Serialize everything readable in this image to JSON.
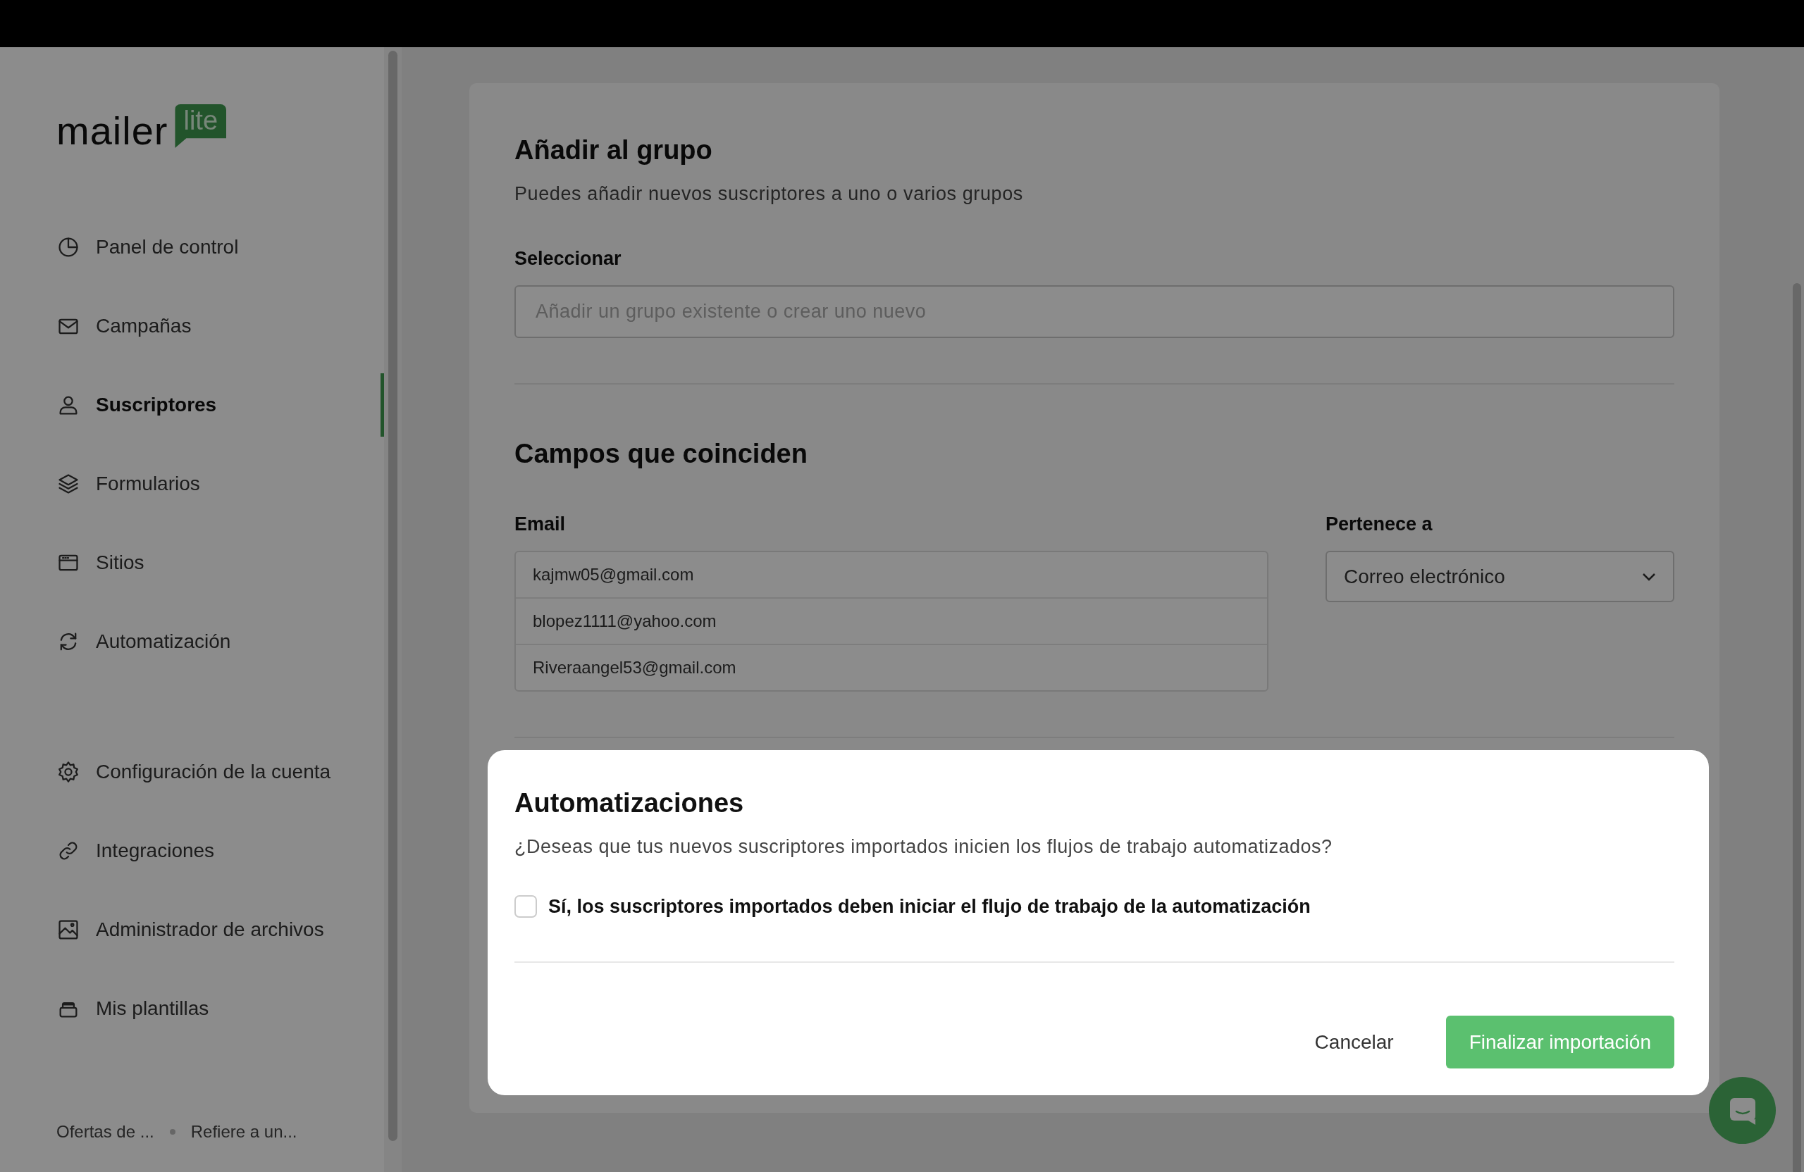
{
  "logo": {
    "word": "mailer",
    "badge": "lite"
  },
  "sidebar": {
    "items": [
      {
        "label": "Panel de control",
        "selected": false
      },
      {
        "label": "Campañas",
        "selected": false
      },
      {
        "label": "Suscriptores",
        "selected": true
      },
      {
        "label": "Formularios",
        "selected": false
      },
      {
        "label": "Sitios",
        "selected": false
      },
      {
        "label": "Automatización",
        "selected": false
      }
    ],
    "secondary_items": [
      {
        "label": "Configuración de la cuenta",
        "selected": false
      },
      {
        "label": "Integraciones",
        "selected": false
      },
      {
        "label": "Administrador de archivos",
        "selected": false
      },
      {
        "label": "Mis plantillas",
        "selected": false
      }
    ],
    "footer_links": [
      "Ofertas de ...",
      "Refiere a un..."
    ]
  },
  "group_section": {
    "title": "Añadir al grupo",
    "subtitle": "Puedes añadir nuevos suscriptores a uno o varios grupos",
    "field": {
      "label": "Seleccionar",
      "placeholder": "Añadir un grupo existente o crear uno nuevo"
    }
  },
  "fields_section": {
    "title": "Campos que coinciden",
    "email_label": "Email",
    "emails": [
      "kajmw05@gmail.com",
      "blopez1111@yahoo.com",
      "Riveraangel53@gmail.com"
    ],
    "belongs_label": "Pertenece a",
    "belongs_value": "Correo electrónico"
  },
  "modal": {
    "title": "Automatizaciones",
    "question": "¿Deseas que tus nuevos suscriptores importados inicien los flujos de trabajo automatizados?",
    "checkbox": {
      "label": "Sí, los suscriptores importados deben iniciar el flujo de trabajo de la automatización",
      "checked": false
    },
    "cancel": "Cancelar",
    "confirm": "Finalizar importación"
  }
}
